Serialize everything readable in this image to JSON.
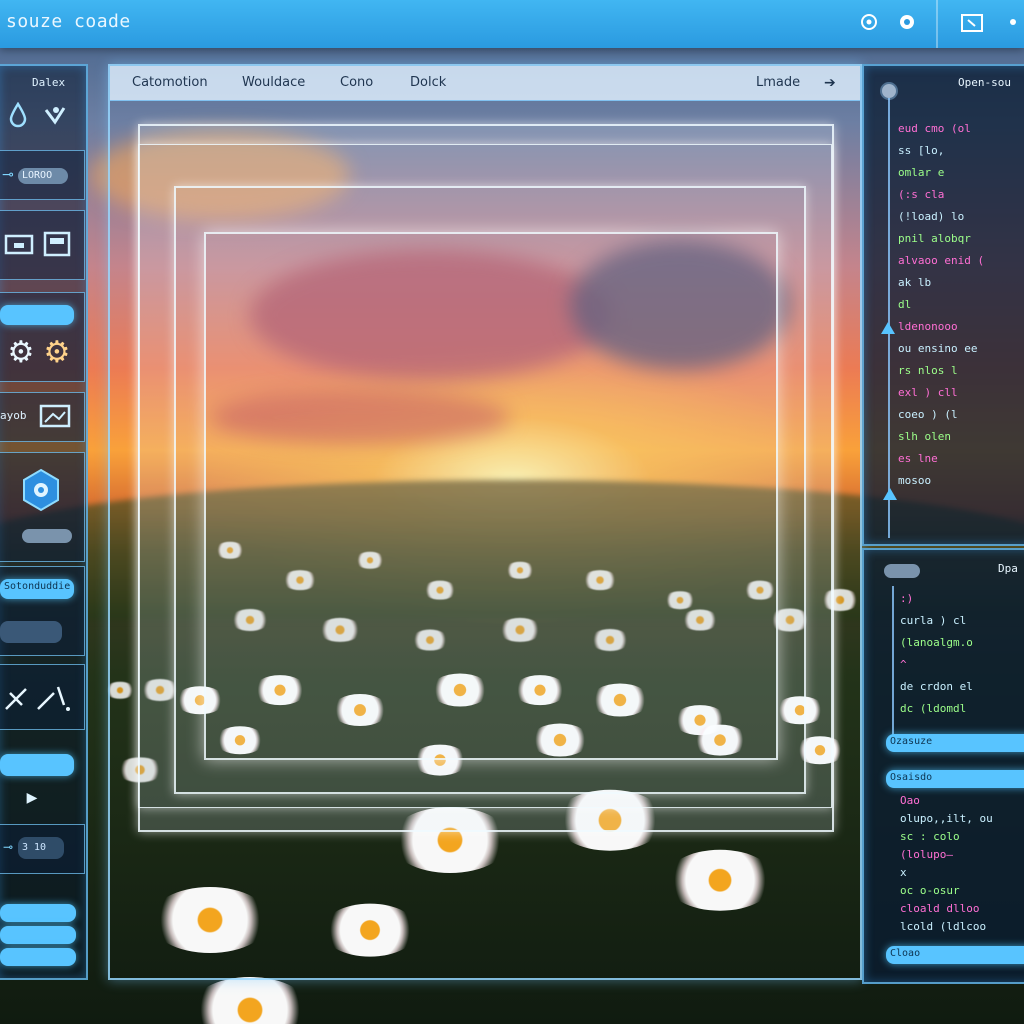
{
  "app": {
    "title": "souze coade"
  },
  "toolbar": {
    "icons": [
      "target-icon",
      "record-icon",
      "window-icon",
      "more-icon"
    ]
  },
  "tabs": [
    {
      "label": "Catomotion"
    },
    {
      "label": "Wouldace"
    },
    {
      "label": "Cono"
    },
    {
      "label": "Dolck"
    }
  ],
  "tab_end": {
    "label": "Lmade",
    "icon": "arrow-right-icon"
  },
  "sidebar": {
    "header": "Dalex",
    "tool_icons": [
      "drop-icon",
      "heart-icon",
      "folder-icon",
      "window-icon",
      "gear-icon",
      "gear-icon",
      "image-icon",
      "hexagon-gear-icon",
      "pen-icon",
      "wand-icon",
      "play-icon"
    ],
    "field_a": "LOROO",
    "field_b": "3 10",
    "label_row": "ayob",
    "pill_label": "Sotonduddie"
  },
  "right_top": {
    "title": "Open-sou",
    "code": [
      "eud  cmo (ol",
      "  ss  [lo,",
      "     omlar  e",
      "   (:s   cla",
      "   (!load) lo",
      "  pnil  alobqr",
      "alvaoo  enid  (",
      "     ak    lb",
      "      dl",
      "   ldenonooo",
      "ou   ensino  ee",
      "     rs  nlos  l",
      "       exl  ) cll",
      "       coeo ) (l",
      "     slh  olen",
      "     es  lne",
      "    mosoo"
    ]
  },
  "right_bottom": {
    "title": "Dpa",
    "code": [
      "  :)",
      "       curla ) cl",
      "       (lanoalgm.o",
      "    ^",
      "  de    crdon el",
      "       dc  (ldomdl"
    ],
    "pill1": "Ozasuze",
    "pill2": "Osaisdo",
    "code2": [
      "  Oao",
      "     olupo,,ilt,  ou",
      "       sc :   colo",
      "          (lolupo—",
      "      x",
      "          oc  o-osur",
      "   cloald   dlloo",
      "  lcold  (ldlcoo"
    ],
    "pill3": "Cloao"
  }
}
